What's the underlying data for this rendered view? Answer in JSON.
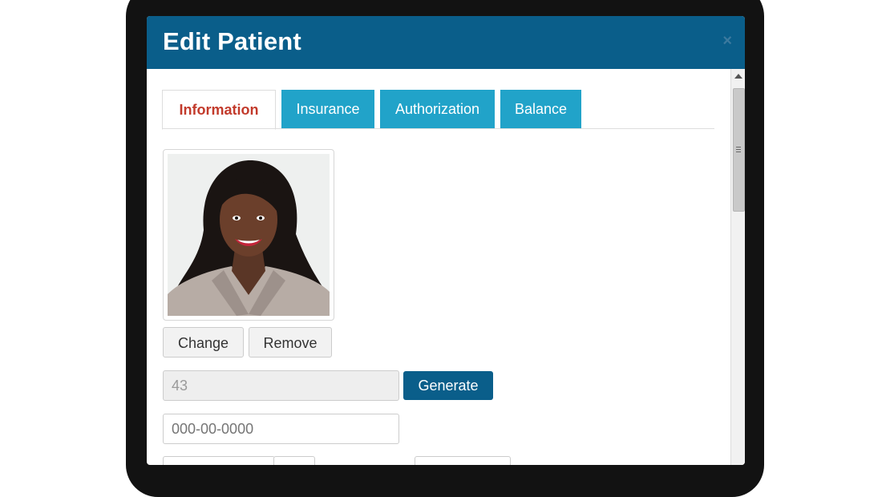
{
  "dialog": {
    "title": "Edit Patient",
    "close_icon": "×"
  },
  "tabs": [
    {
      "label": "Information",
      "active": true
    },
    {
      "label": "Insurance",
      "active": false
    },
    {
      "label": "Authorization",
      "active": false
    },
    {
      "label": "Balance",
      "active": false
    }
  ],
  "photo_buttons": {
    "change_label": "Change",
    "remove_label": "Remove"
  },
  "patient_id": {
    "value": "43",
    "generate_label": "Generate"
  },
  "ssn_field": {
    "placeholder": "000-00-0000"
  },
  "colors": {
    "header": "#0a5e8a",
    "tab_blue": "#21a3c9",
    "active_tab_text": "#c23a2b"
  }
}
